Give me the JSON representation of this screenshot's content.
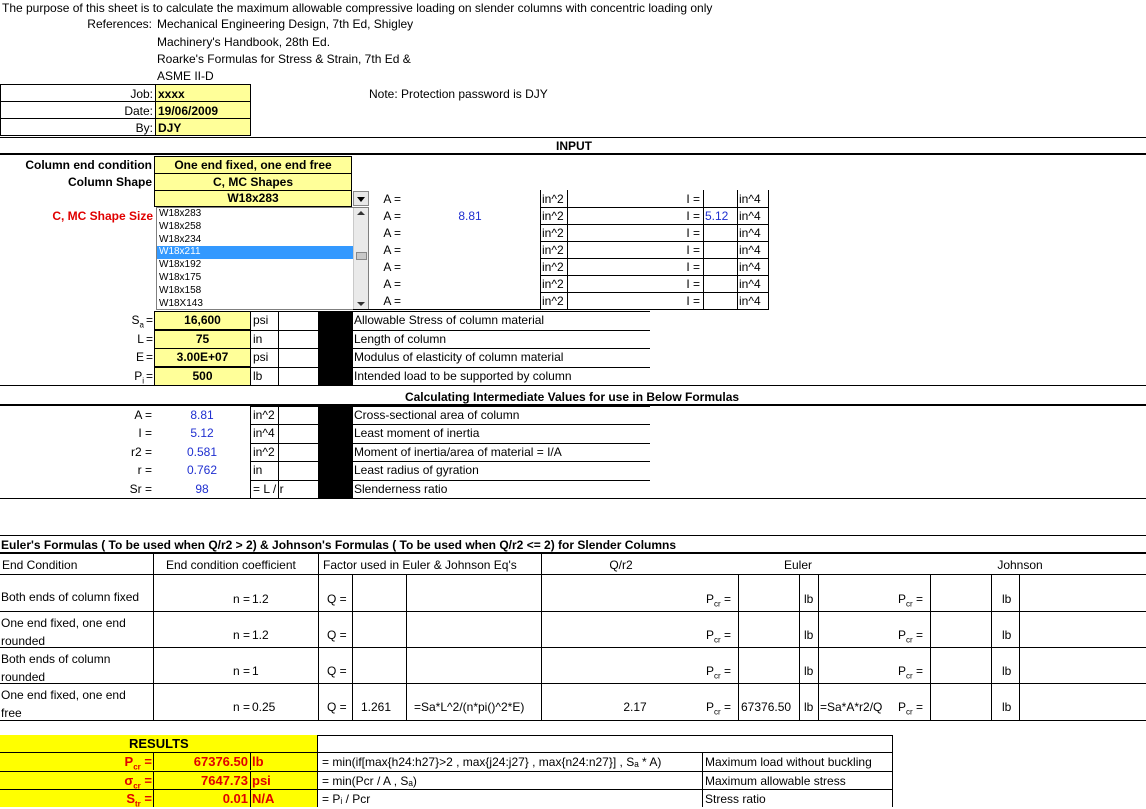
{
  "header": {
    "purpose": "The purpose of this sheet is to calculate the maximum allowable compressive loading on slender columns with concentric loading only",
    "references_label": "References:",
    "references": [
      "Mechanical Engineering Design, 7th Ed, Shigley",
      "Machinery's Handbook, 28th Ed.",
      "Roarke's Formulas for Stress & Strain, 7th Ed &",
      "ASME II-D"
    ],
    "job_label": "Job:",
    "job": "xxxx",
    "date_label": "Date:",
    "date": "19/06/2009",
    "by_label": "By:",
    "by": "DJY",
    "note": "Note: Protection password is DJY"
  },
  "input": {
    "title": "INPUT",
    "end_condition_label": "Column end condition",
    "end_condition": "One end fixed, one end free",
    "shape_label": "Column Shape",
    "shape": "C, MC Shapes",
    "size_label": "C, MC Shape Size",
    "size": "W18x283",
    "dropdown_options": [
      "W18x283",
      "W18x258",
      "W18x234",
      "W18x211",
      "W18x192",
      "W18x175",
      "W18x158",
      "W18X143"
    ],
    "dropdown_selected_index": 3,
    "area_rows": [
      {
        "a_label": "A =",
        "a_value": "",
        "a_unit": "in^2",
        "i_label": "I =",
        "i_value": "",
        "i_unit": "in^4"
      },
      {
        "a_label": "A =",
        "a_value": "8.81",
        "a_unit": "in^2",
        "i_label": "I =",
        "i_value": "5.12",
        "i_unit": "in^4"
      },
      {
        "a_label": "A =",
        "a_value": "",
        "a_unit": "in^2",
        "i_label": "I =",
        "i_value": "",
        "i_unit": "in^4"
      },
      {
        "a_label": "A =",
        "a_value": "",
        "a_unit": "in^2",
        "i_label": "I =",
        "i_value": "",
        "i_unit": "in^4"
      },
      {
        "a_label": "A =",
        "a_value": "",
        "a_unit": "in^2",
        "i_label": "I =",
        "i_value": "",
        "i_unit": "in^4"
      },
      {
        "a_label": "A =",
        "a_value": "",
        "a_unit": "in^2",
        "i_label": "I =",
        "i_value": "",
        "i_unit": "in^4"
      },
      {
        "a_label": "A =",
        "a_value": "",
        "a_unit": "in^2",
        "i_label": "I =",
        "i_value": "",
        "i_unit": "in^4"
      }
    ],
    "params": [
      {
        "sym": "S",
        "sub": "a",
        "eq": "=",
        "value": "16,600",
        "unit": "psi",
        "desc": "Allowable Stress of column material"
      },
      {
        "sym": "L",
        "sub": "",
        "eq": "=",
        "value": "75",
        "unit": "in",
        "desc": "Length of column"
      },
      {
        "sym": "E",
        "sub": "",
        "eq": "=",
        "value": "3.00E+07",
        "unit": "psi",
        "desc": "Modulus of elasticity of column material"
      },
      {
        "sym": "P",
        "sub": "i",
        "eq": "=",
        "value": "500",
        "unit": "lb",
        "desc": "Intended load to be supported by column"
      }
    ]
  },
  "intermediate": {
    "title": "Calculating Intermediate Values for use in Below Formulas",
    "rows": [
      {
        "label": "A =",
        "value": "8.81",
        "unit": "in^2",
        "desc": "Cross-sectional area of column"
      },
      {
        "label": "I =",
        "value": "5.12",
        "unit": "in^4",
        "desc": "Least moment of inertia"
      },
      {
        "label": "r2 =",
        "value": "0.581",
        "unit": "in^2",
        "desc": "Moment of inertia/area of material = I/A"
      },
      {
        "label": "r =",
        "value": "0.762",
        "unit": "in",
        "desc": "Least radius of gyration"
      },
      {
        "label": "Sr =",
        "value": "98",
        "unit": "= L / r",
        "desc": "Slenderness ratio"
      }
    ]
  },
  "euler": {
    "title": "Euler's Formulas ( To be used when Q/r2 > 2) & Johnson's Formulas ( To be used when Q/r2 <= 2) for Slender Columns",
    "headers": [
      "End Condition",
      "End condition coefficient",
      "Factor used in Euler & Johnson Eq's",
      "Q/r2",
      "Euler",
      "Johnson"
    ],
    "rows": [
      {
        "cond1": "Both ends of column fixed",
        "cond2": "",
        "n": "1.2",
        "q": "",
        "formula": "",
        "qr2": "",
        "pcr_e": "",
        "formula_e": ""
      },
      {
        "cond1": "One end fixed, one end",
        "cond2": "rounded",
        "n": "1.2",
        "q": "",
        "formula": "",
        "qr2": "",
        "pcr_e": "",
        "formula_e": ""
      },
      {
        "cond1": "Both ends of column",
        "cond2": "rounded",
        "n": "1",
        "q": "",
        "formula": "",
        "qr2": "",
        "pcr_e": "",
        "formula_e": ""
      },
      {
        "cond1": "One end fixed, one end",
        "cond2": "free",
        "n": "0.25",
        "q": "1.261",
        "formula": "=Sa*L^2/(n*pi()^2*E)",
        "qr2": "2.17",
        "pcr_e": "67376.50",
        "formula_e": "=Sa*A*r2/Q"
      }
    ],
    "n_label": "n =",
    "q_label": "Q =",
    "pcr_label": "Pcr =",
    "lb": "lb"
  },
  "results": {
    "title": "RESULTS",
    "rows": [
      {
        "sym": "P",
        "sub": "cr",
        "value": "67376.50",
        "unit": "lb",
        "formula": "= min(if[max{h24:h27}>2 , max{j24:j27} , max{n24:n27}] , Sₐ * A)",
        "desc": "Maximum load without buckling"
      },
      {
        "sym": "σ",
        "sub": "cr",
        "value": "7647.73",
        "unit": "psi",
        "formula": "= min(Pcr / A , Sₐ)",
        "desc": "Maximum allowable stress"
      },
      {
        "sym": "S",
        "sub": "tr",
        "value": "0.01",
        "unit": "N/A",
        "formula": "= Pᵢ / Pcr",
        "desc": "Stress ratio"
      }
    ]
  }
}
